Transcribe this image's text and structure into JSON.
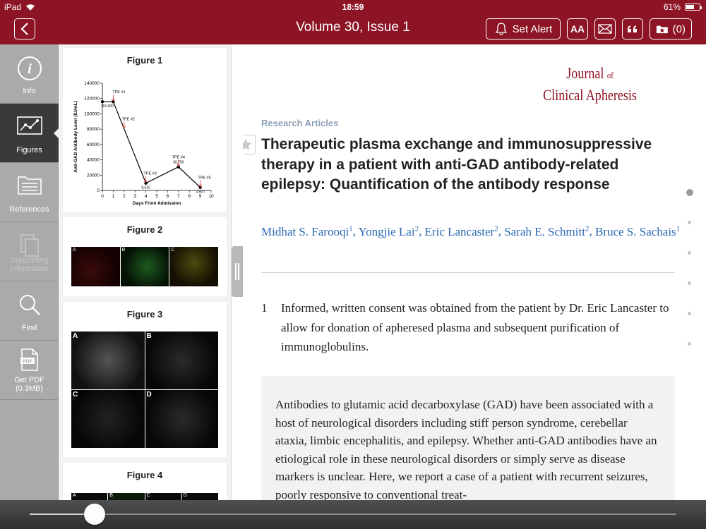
{
  "status_bar": {
    "device": "iPad",
    "time": "18:59",
    "battery": "61%",
    "battery_level": 0.61
  },
  "nav": {
    "title": "Volume 30, Issue 1",
    "set_alert_label": "Set Alert",
    "font_size_label": "AA",
    "saved_count": "(0)"
  },
  "sidebar": {
    "items": [
      {
        "label": "Info",
        "icon": "info-icon"
      },
      {
        "label": "Figures",
        "icon": "chart-icon"
      },
      {
        "label": "References",
        "icon": "references-icon"
      },
      {
        "label": "Supporting Information",
        "icon": "copy-icon"
      },
      {
        "label": "Find",
        "icon": "search-icon"
      },
      {
        "label": "Get PDF (0.3MB)",
        "icon": "pdf-icon"
      }
    ]
  },
  "figures": [
    {
      "title": "Figure 1"
    },
    {
      "title": "Figure 2",
      "panels": [
        "A",
        "B",
        "C"
      ]
    },
    {
      "title": "Figure 3",
      "panels": [
        "A",
        "B",
        "C",
        "D"
      ]
    },
    {
      "title": "Figure 4",
      "panels": [
        "A",
        "B",
        "C",
        "D"
      ]
    }
  ],
  "chart_data": {
    "type": "line",
    "ylabel": "Anti-GAD Antibody Level (IU/mL)",
    "xlabel": "Days From Admission",
    "x": [
      0,
      1,
      4,
      7,
      9
    ],
    "y": [
      115900,
      115900,
      9510,
      30750,
      3970
    ],
    "point_labels": [
      "115,900",
      "",
      "9,510",
      "30,750",
      "3,970"
    ],
    "annotations": [
      {
        "text": "TPE #1",
        "x": 1
      },
      {
        "text": "TPE #2",
        "x": 2
      },
      {
        "text": "TPE #3",
        "x": 4
      },
      {
        "text": "TPE #4",
        "x": 7
      },
      {
        "text": "TPE #5",
        "x": 9
      }
    ],
    "xticks": [
      "0",
      "1",
      "2",
      "3",
      "4",
      "5",
      "6",
      "7",
      "8",
      "9",
      "10"
    ],
    "yticks": [
      "0",
      "20000",
      "40000",
      "60000",
      "80000",
      "100000",
      "120000",
      "140000"
    ],
    "xlim": [
      0,
      10
    ],
    "ylim": [
      0,
      140000
    ],
    "colors": {
      "line": "#000000",
      "marker": "#000000",
      "arrow": "#d9332b"
    }
  },
  "article": {
    "journal_line1": "Journal",
    "journal_of": "of",
    "journal_line2": "Clinical Apheresis",
    "section": "Research Articles",
    "title": "Therapeutic plasma exchange and immunosuppressive therapy in a patient with anti-GAD antibody-related epilepsy: Quantification of the antibody response",
    "authors": [
      {
        "name": "Midhat S. Farooqi",
        "aff": "1"
      },
      {
        "name": "Yongjie Lai",
        "aff": "2"
      },
      {
        "name": "Eric Lancaster",
        "aff": "2"
      },
      {
        "name": "Sarah E. Schmitt",
        "aff": "2"
      },
      {
        "name": "Bruce S. Sachais",
        "aff": "1"
      }
    ],
    "footnote_num": "1",
    "footnote_text": "Informed, written consent was obtained from the patient by Dr. Eric Lancaster to allow for donation of apheresed plasma and subsequent purification of immunoglobulins.",
    "abstract_text": "Antibodies to glutamic acid decarboxylase (GAD) have been associated with a host of neurological disorders including stiff person syndrome, cerebellar ataxia, limbic encephalitis, and epilepsy. Whether anti-GAD antibodies have an etiological role in these neurological disorders or simply serve as disease markers is unclear. Here, we report a case of a patient with recurrent seizures, poorly responsive to conventional treat-"
  },
  "page_dots": {
    "count": 6,
    "current": 0
  },
  "slider": {
    "position": 0.1
  },
  "colors": {
    "brand": "#8c1424",
    "link": "#2a67b3",
    "section": "#8da0b4"
  }
}
